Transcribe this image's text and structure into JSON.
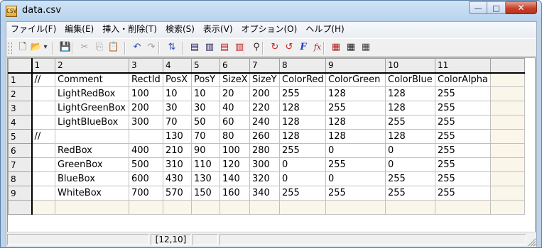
{
  "window": {
    "title": "data.csv",
    "app_icon_text": "CSV"
  },
  "caption": {
    "minimize": "—",
    "maximize": "□",
    "close": "✕"
  },
  "menu": [
    "ファイル(F)",
    "編集(E)",
    "挿入・削除(T)",
    "検索(S)",
    "表示(V)",
    "オプション(O)",
    "ヘルプ(H)"
  ],
  "toolbar": {
    "buttons": [
      {
        "name": "new-file-icon",
        "glyph": "🗋",
        "color": "#333333"
      },
      {
        "name": "open-file-icon",
        "glyph": "📂",
        "color": "#c08a20"
      },
      {
        "name": "open-dropdown-icon",
        "glyph": "▾",
        "color": "#333333"
      },
      {
        "name": "save-icon",
        "glyph": "💾",
        "color": "#8a8a8a"
      },
      {
        "name": "cut-icon",
        "glyph": "✂",
        "color": "#a0a0a0"
      },
      {
        "name": "copy-icon",
        "glyph": "⎘",
        "color": "#a0a0a0"
      },
      {
        "name": "paste-icon",
        "glyph": "📋",
        "color": "#a0a0a0"
      },
      {
        "name": "undo-icon",
        "glyph": "↶",
        "color": "#2a4fb0"
      },
      {
        "name": "redo-icon",
        "glyph": "↷",
        "color": "#a0a0a0"
      },
      {
        "name": "sort-icon",
        "glyph": "⇅",
        "color": "#2a4fb0"
      },
      {
        "name": "insert-row-icon",
        "glyph": "▤",
        "color": "#202060"
      },
      {
        "name": "insert-col-icon",
        "glyph": "▥",
        "color": "#202060"
      },
      {
        "name": "delete-row-icon",
        "glyph": "▤",
        "color": "#c02020"
      },
      {
        "name": "delete-col-icon",
        "glyph": "▥",
        "color": "#c02020"
      },
      {
        "name": "find-icon",
        "glyph": "⚲",
        "color": "#202020"
      },
      {
        "name": "recalc-icon",
        "glyph": "↻",
        "color": "#d02020"
      },
      {
        "name": "recalc-all-icon",
        "glyph": "↺",
        "color": "#d02020"
      },
      {
        "name": "font-icon",
        "glyph": "F",
        "color": "#2040c0"
      },
      {
        "name": "function-icon",
        "glyph": "fx",
        "color": "#a02020"
      },
      {
        "name": "grid-red-icon",
        "glyph": "▦",
        "color": "#b02020"
      },
      {
        "name": "grid-black-icon",
        "glyph": "▦",
        "color": "#202020"
      },
      {
        "name": "grid-dark-icon",
        "glyph": "▦",
        "color": "#404040"
      }
    ]
  },
  "grid": {
    "column_headers": [
      "",
      "1",
      "2",
      "3",
      "4",
      "5",
      "6",
      "7",
      "8",
      "9",
      "10",
      "11",
      ""
    ],
    "rows": [
      {
        "header": "1",
        "cells": [
          "//",
          "Comment",
          "RectId",
          "PosX",
          "PosY",
          "SizeX",
          "SizeY",
          "ColorRed",
          "ColorGreen",
          "ColorBlue",
          "ColorAlpha"
        ]
      },
      {
        "header": "2",
        "cells": [
          "",
          "LightRedBox",
          "100",
          "10",
          "10",
          "20",
          "200",
          "255",
          "128",
          "128",
          "255"
        ]
      },
      {
        "header": "3",
        "cells": [
          "",
          "LightGreenBox",
          "200",
          "30",
          "30",
          "40",
          "220",
          "128",
          "255",
          "128",
          "255"
        ]
      },
      {
        "header": "4",
        "cells": [
          "",
          "LightBlueBox",
          "300",
          "70",
          "50",
          "60",
          "240",
          "128",
          "128",
          "255",
          "255"
        ]
      },
      {
        "header": "5",
        "cells": [
          "//",
          "",
          "",
          "130",
          "70",
          "80",
          "260",
          "128",
          "128",
          "128",
          "255"
        ]
      },
      {
        "header": "6",
        "cells": [
          "",
          "RedBox",
          "400",
          "210",
          "90",
          "100",
          "280",
          "255",
          "0",
          "0",
          "255"
        ]
      },
      {
        "header": "7",
        "cells": [
          "",
          "GreenBox",
          "500",
          "310",
          "110",
          "120",
          "300",
          "0",
          "255",
          "0",
          "255"
        ]
      },
      {
        "header": "8",
        "cells": [
          "",
          "BlueBox",
          "600",
          "430",
          "130",
          "140",
          "320",
          "0",
          "0",
          "255",
          "255"
        ]
      },
      {
        "header": "9",
        "cells": [
          "",
          "WhiteBox",
          "700",
          "570",
          "150",
          "160",
          "340",
          "255",
          "255",
          "255",
          "255"
        ]
      }
    ]
  },
  "status": {
    "position": "[12,10]"
  }
}
